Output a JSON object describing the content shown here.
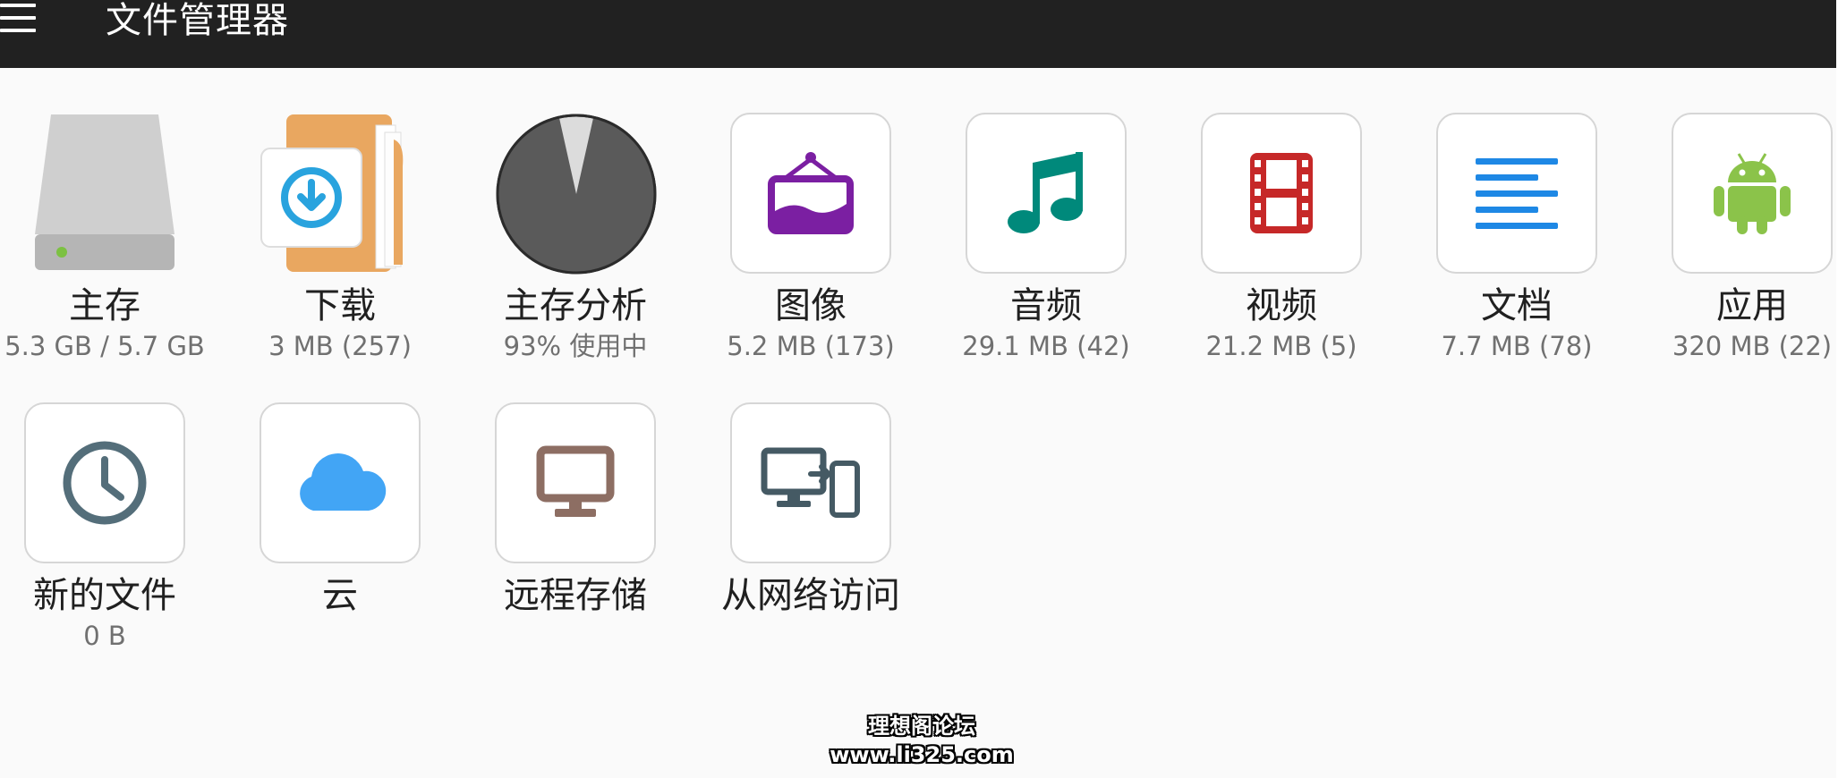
{
  "app": {
    "title": "文件管理器"
  },
  "tiles_row1": [
    {
      "label": "主存",
      "sub": "5.3 GB / 5.7 GB",
      "icon": "hard-drive-icon"
    },
    {
      "label": "下载",
      "sub": "3 MB (257)",
      "icon": "download-folder-icon"
    },
    {
      "label": "主存分析",
      "sub": "93% 使用中",
      "icon": "storage-pie-icon",
      "used_fraction": 0.93
    },
    {
      "label": "图像",
      "sub": "5.2 MB (173)",
      "icon": "image-frame-icon"
    },
    {
      "label": "音频",
      "sub": "29.1 MB (42)",
      "icon": "music-note-icon"
    },
    {
      "label": "视频",
      "sub": "21.2 MB (5)",
      "icon": "film-strip-icon"
    },
    {
      "label": "文档",
      "sub": "7.7 MB (78)",
      "icon": "document-lines-icon"
    },
    {
      "label": "应用",
      "sub": "320 MB (22)",
      "icon": "android-icon"
    }
  ],
  "tiles_row2": [
    {
      "label": "新的文件",
      "sub": "0 B",
      "icon": "clock-icon"
    },
    {
      "label": "云",
      "sub": "",
      "icon": "cloud-icon"
    },
    {
      "label": "远程存储",
      "sub": "",
      "icon": "monitor-icon"
    },
    {
      "label": "从网络访问",
      "sub": "",
      "icon": "network-devices-icon"
    }
  ],
  "watermark": {
    "line1": "理想阁论坛",
    "line2": "www.li325.com"
  },
  "colors": {
    "appbar": "#212121",
    "background": "#fafafa",
    "image_purple": "#7b1fa2",
    "audio_teal": "#00897b",
    "video_red": "#c62828",
    "docs_blue": "#1e88e5",
    "android_green": "#8bc34a",
    "clock_slate": "#546e7a",
    "cloud_blue": "#42a5f5",
    "monitor_brown": "#8d6e63",
    "network_gray": "#455a64",
    "folder_orange": "#e9a760"
  }
}
